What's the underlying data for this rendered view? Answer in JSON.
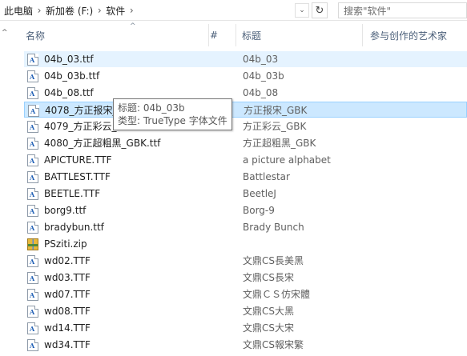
{
  "address": {
    "crumbs": [
      "此电脑",
      "新加卷 (F:)",
      "软件"
    ],
    "separator": "›",
    "dropdown_glyph": "⌄",
    "refresh_glyph": "↻"
  },
  "search": {
    "placeholder": "搜索\"软件\""
  },
  "columns": {
    "name": "名称",
    "number": "#",
    "title": "标题",
    "artist": "参与创作的艺术家",
    "sort_glyph": "^"
  },
  "nav": {
    "up_glyph": "^"
  },
  "files": [
    {
      "name": "04b_03.ttf",
      "title": "04b_03",
      "type": "font",
      "state": "hover"
    },
    {
      "name": "04b_03b.ttf",
      "title": "04b_03b",
      "type": "font",
      "state": ""
    },
    {
      "name": "04b_08.ttf",
      "title": "04b_08",
      "type": "font",
      "state": ""
    },
    {
      "name": "4078_方正报宋_",
      "title": "方正报宋_GBK",
      "type": "font",
      "state": "selected"
    },
    {
      "name": "4079_方正彩云_",
      "title": "方正彩云_GBK",
      "type": "font",
      "state": ""
    },
    {
      "name": "4080_方正超粗黑_GBK.ttf",
      "title": "方正超粗黑_GBK",
      "type": "font",
      "state": ""
    },
    {
      "name": "APICTURE.TTF",
      "title": "a picture alphabet",
      "type": "font",
      "state": ""
    },
    {
      "name": "BATTLEST.TTF",
      "title": "Battlestar",
      "type": "font",
      "state": ""
    },
    {
      "name": "BEETLE.TTF",
      "title": "BeetleJ",
      "type": "font",
      "state": ""
    },
    {
      "name": "borg9.ttf",
      "title": "Borg-9",
      "type": "font",
      "state": ""
    },
    {
      "name": "bradybun.ttf",
      "title": "Brady Bunch",
      "type": "font",
      "state": ""
    },
    {
      "name": "PSziti.zip",
      "title": "",
      "type": "zip",
      "state": ""
    },
    {
      "name": "wd02.TTF",
      "title": "文鼎CS長美黑",
      "type": "font",
      "state": ""
    },
    {
      "name": "wd03.TTF",
      "title": "文鼎CS長宋",
      "type": "font",
      "state": ""
    },
    {
      "name": "wd07.TTF",
      "title": "文鼎ＣＳ仿宋體",
      "type": "font",
      "state": ""
    },
    {
      "name": "wd08.TTF",
      "title": "文鼎CS大黑",
      "type": "font",
      "state": ""
    },
    {
      "name": "wd14.TTF",
      "title": "文鼎CS大宋",
      "type": "font",
      "state": ""
    },
    {
      "name": "wd34.TTF",
      "title": "文鼎CS報宋繁",
      "type": "font",
      "state": ""
    }
  ],
  "tooltip": {
    "title_line": "标题: 04b_03b",
    "type_line": "类型: TrueType 字体文件"
  }
}
